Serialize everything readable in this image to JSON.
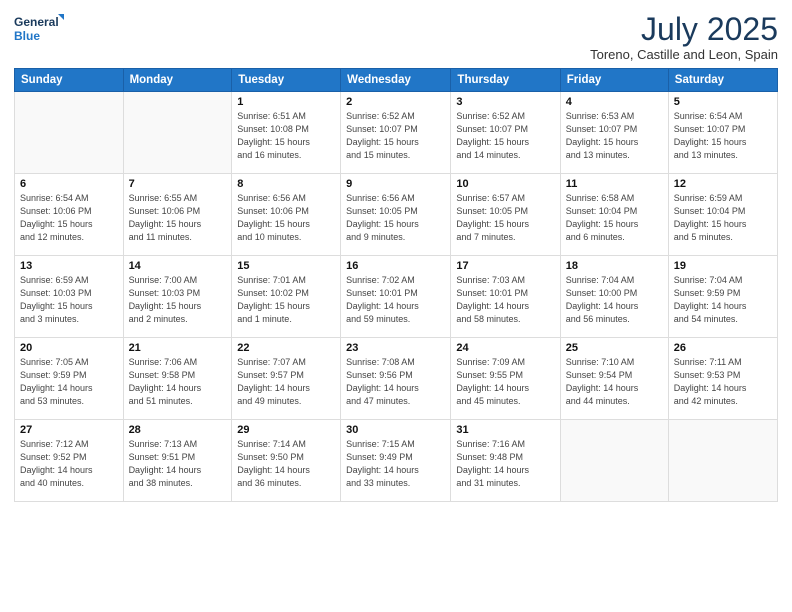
{
  "header": {
    "logo_line1": "General",
    "logo_line2": "Blue",
    "main_title": "July 2025",
    "subtitle": "Toreno, Castille and Leon, Spain"
  },
  "weekdays": [
    "Sunday",
    "Monday",
    "Tuesday",
    "Wednesday",
    "Thursday",
    "Friday",
    "Saturday"
  ],
  "weeks": [
    [
      {
        "day": "",
        "info": ""
      },
      {
        "day": "",
        "info": ""
      },
      {
        "day": "1",
        "info": "Sunrise: 6:51 AM\nSunset: 10:08 PM\nDaylight: 15 hours\nand 16 minutes."
      },
      {
        "day": "2",
        "info": "Sunrise: 6:52 AM\nSunset: 10:07 PM\nDaylight: 15 hours\nand 15 minutes."
      },
      {
        "day": "3",
        "info": "Sunrise: 6:52 AM\nSunset: 10:07 PM\nDaylight: 15 hours\nand 14 minutes."
      },
      {
        "day": "4",
        "info": "Sunrise: 6:53 AM\nSunset: 10:07 PM\nDaylight: 15 hours\nand 13 minutes."
      },
      {
        "day": "5",
        "info": "Sunrise: 6:54 AM\nSunset: 10:07 PM\nDaylight: 15 hours\nand 13 minutes."
      }
    ],
    [
      {
        "day": "6",
        "info": "Sunrise: 6:54 AM\nSunset: 10:06 PM\nDaylight: 15 hours\nand 12 minutes."
      },
      {
        "day": "7",
        "info": "Sunrise: 6:55 AM\nSunset: 10:06 PM\nDaylight: 15 hours\nand 11 minutes."
      },
      {
        "day": "8",
        "info": "Sunrise: 6:56 AM\nSunset: 10:06 PM\nDaylight: 15 hours\nand 10 minutes."
      },
      {
        "day": "9",
        "info": "Sunrise: 6:56 AM\nSunset: 10:05 PM\nDaylight: 15 hours\nand 9 minutes."
      },
      {
        "day": "10",
        "info": "Sunrise: 6:57 AM\nSunset: 10:05 PM\nDaylight: 15 hours\nand 7 minutes."
      },
      {
        "day": "11",
        "info": "Sunrise: 6:58 AM\nSunset: 10:04 PM\nDaylight: 15 hours\nand 6 minutes."
      },
      {
        "day": "12",
        "info": "Sunrise: 6:59 AM\nSunset: 10:04 PM\nDaylight: 15 hours\nand 5 minutes."
      }
    ],
    [
      {
        "day": "13",
        "info": "Sunrise: 6:59 AM\nSunset: 10:03 PM\nDaylight: 15 hours\nand 3 minutes."
      },
      {
        "day": "14",
        "info": "Sunrise: 7:00 AM\nSunset: 10:03 PM\nDaylight: 15 hours\nand 2 minutes."
      },
      {
        "day": "15",
        "info": "Sunrise: 7:01 AM\nSunset: 10:02 PM\nDaylight: 15 hours\nand 1 minute."
      },
      {
        "day": "16",
        "info": "Sunrise: 7:02 AM\nSunset: 10:01 PM\nDaylight: 14 hours\nand 59 minutes."
      },
      {
        "day": "17",
        "info": "Sunrise: 7:03 AM\nSunset: 10:01 PM\nDaylight: 14 hours\nand 58 minutes."
      },
      {
        "day": "18",
        "info": "Sunrise: 7:04 AM\nSunset: 10:00 PM\nDaylight: 14 hours\nand 56 minutes."
      },
      {
        "day": "19",
        "info": "Sunrise: 7:04 AM\nSunset: 9:59 PM\nDaylight: 14 hours\nand 54 minutes."
      }
    ],
    [
      {
        "day": "20",
        "info": "Sunrise: 7:05 AM\nSunset: 9:59 PM\nDaylight: 14 hours\nand 53 minutes."
      },
      {
        "day": "21",
        "info": "Sunrise: 7:06 AM\nSunset: 9:58 PM\nDaylight: 14 hours\nand 51 minutes."
      },
      {
        "day": "22",
        "info": "Sunrise: 7:07 AM\nSunset: 9:57 PM\nDaylight: 14 hours\nand 49 minutes."
      },
      {
        "day": "23",
        "info": "Sunrise: 7:08 AM\nSunset: 9:56 PM\nDaylight: 14 hours\nand 47 minutes."
      },
      {
        "day": "24",
        "info": "Sunrise: 7:09 AM\nSunset: 9:55 PM\nDaylight: 14 hours\nand 45 minutes."
      },
      {
        "day": "25",
        "info": "Sunrise: 7:10 AM\nSunset: 9:54 PM\nDaylight: 14 hours\nand 44 minutes."
      },
      {
        "day": "26",
        "info": "Sunrise: 7:11 AM\nSunset: 9:53 PM\nDaylight: 14 hours\nand 42 minutes."
      }
    ],
    [
      {
        "day": "27",
        "info": "Sunrise: 7:12 AM\nSunset: 9:52 PM\nDaylight: 14 hours\nand 40 minutes."
      },
      {
        "day": "28",
        "info": "Sunrise: 7:13 AM\nSunset: 9:51 PM\nDaylight: 14 hours\nand 38 minutes."
      },
      {
        "day": "29",
        "info": "Sunrise: 7:14 AM\nSunset: 9:50 PM\nDaylight: 14 hours\nand 36 minutes."
      },
      {
        "day": "30",
        "info": "Sunrise: 7:15 AM\nSunset: 9:49 PM\nDaylight: 14 hours\nand 33 minutes."
      },
      {
        "day": "31",
        "info": "Sunrise: 7:16 AM\nSunset: 9:48 PM\nDaylight: 14 hours\nand 31 minutes."
      },
      {
        "day": "",
        "info": ""
      },
      {
        "day": "",
        "info": ""
      }
    ]
  ]
}
